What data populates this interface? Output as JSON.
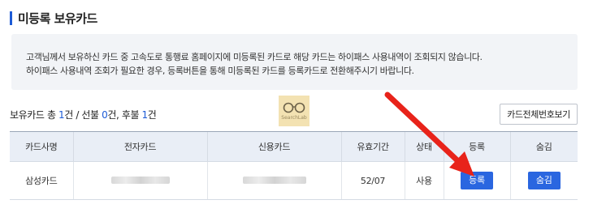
{
  "section": {
    "title": "미등록 보유카드"
  },
  "notice": {
    "line1": "고객님께서 보유하신 카드 중 고속도로 통행료 홈페이지에 미등록된 카드로 해당 카드는 하이패스 사용내역이 조회되지 않습니다.",
    "line2": "하이패스 사용내역 조회가 필요한 경우, 등록버튼을 통해 미등록된 카드를 등록카드로 전환해주시기 바랍니다."
  },
  "summary": {
    "prefix": "보유카드 총 ",
    "total": "1",
    "unit1": "건 / 선불 ",
    "prepaid": "0",
    "unit2": "건, 후불 ",
    "postpaid": "1",
    "unit3": "건"
  },
  "watermark": {
    "text": "SearchLab"
  },
  "buttons": {
    "view_all_numbers": "카드전체번호보기"
  },
  "table": {
    "headers": [
      "카드사명",
      "전자카드",
      "신용카드",
      "유효기간",
      "상태",
      "등록",
      "숨김"
    ],
    "rows": [
      {
        "company": "삼성카드",
        "expiry": "52/07",
        "status": "사용",
        "register_label": "등록",
        "hide_label": "숨김"
      }
    ]
  },
  "colors": {
    "accent": "#1d5bd6",
    "button": "#2a66e0",
    "arrow": "#e8231a"
  },
  "icons": {
    "watermark": "glasses-icon",
    "annotation": "red-arrow-icon"
  }
}
